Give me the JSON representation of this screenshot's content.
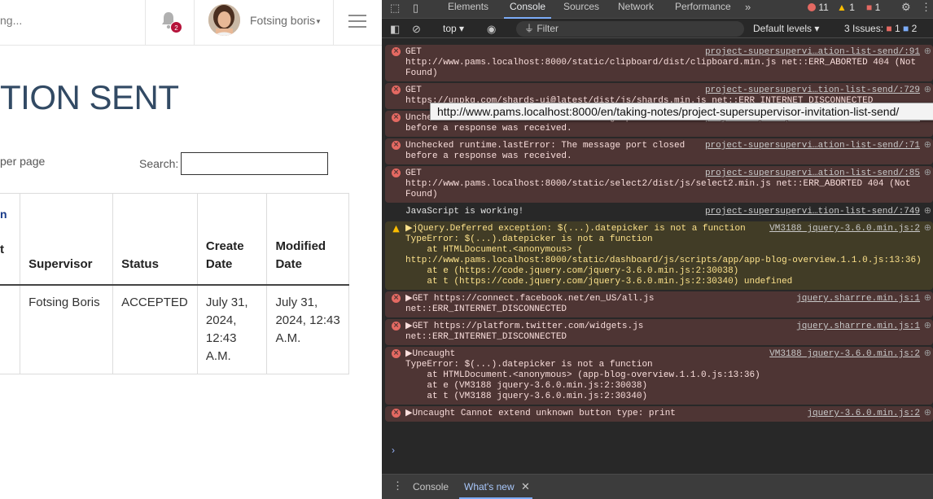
{
  "webpage": {
    "search_fragment": "ng...",
    "notifications": {
      "count": "2"
    },
    "user": {
      "name": "Fotsing boris"
    },
    "page_title": "TION SENT",
    "per_page_fragment": "per page",
    "search_label": "Search:",
    "header_fragment_top": "n",
    "header_fragment_t": "t",
    "table": {
      "headers": [
        "Supervisor",
        "Status",
        "Create Date",
        "Modified Date"
      ],
      "rows": [
        {
          "supervisor": "Fotsing Boris",
          "status": "ACCEPTED",
          "create_date": "July 31, 2024, 12:43 A.M.",
          "modified_date": "July 31, 2024, 12:43 A.M."
        }
      ]
    },
    "colors": {
      "accepted": "#2d9a2d",
      "title": "#324a64",
      "badge": "#b5123a"
    }
  },
  "devtools": {
    "tabs": [
      "Elements",
      "Console",
      "Sources",
      "Network",
      "Performance"
    ],
    "active_tab": "Console",
    "counts": {
      "errors": "11",
      "warnings": "1",
      "messages": "1"
    },
    "toolbar": {
      "context": "top",
      "filter_placeholder": "Filter",
      "levels": "Default levels",
      "issues_label": "3 Issues:",
      "issues_errors": "1",
      "issues_info": "2"
    },
    "tooltip": "http://www.pams.localhost:8000/en/taking-notes/project-supersupervisor-invitation-list-send/",
    "messages": [
      {
        "level": "error",
        "lines": [
          "GET",
          "http://www.pams.localhost:8000/static/clipboard/dist/clipboard.min.js net::ERR_ABORTED 404 (Not",
          "Found)"
        ],
        "source": "project-supersupervi…ation-list-send/:91"
      },
      {
        "level": "error",
        "lines": [
          "GET",
          "https://unpkg.com/shards-ui@latest/dist/js/shards.min.js net::ERR_INTERNET_DISCONNECTED"
        ],
        "source": "project-supersupervi…tion-list-send/:729"
      },
      {
        "level": "error",
        "lines": [
          "Unchecked runtime.lastError: The message port closed",
          "before a response was received."
        ],
        "source": "project-supersupervi…ation-list-send/:71"
      },
      {
        "level": "error",
        "lines": [
          "Unchecked runtime.lastError: The message port closed",
          "before a response was received."
        ],
        "source": "project-supersupervi…ation-list-send/:71"
      },
      {
        "level": "error",
        "lines": [
          "GET",
          "http://www.pams.localhost:8000/static/select2/dist/js/select2.min.js net::ERR_ABORTED 404 (Not",
          "Found)"
        ],
        "source": "project-supersupervi…ation-list-send/:85"
      },
      {
        "level": "info",
        "lines": [
          "JavaScript is working!"
        ],
        "source": "project-supersupervi…tion-list-send/:749"
      },
      {
        "level": "warn",
        "lines": [
          "▶jQuery.Deferred exception: $(...).datepicker is not a function",
          "TypeError: $(...).datepicker is not a function",
          "    at HTMLDocument.<anonymous> (",
          "http://www.pams.localhost:8000/static/dashboard/js/scripts/app/app-blog-overview.1.1.0.js:13:36)",
          "    at e (https://code.jquery.com/jquery-3.6.0.min.js:2:30038)",
          "    at t (https://code.jquery.com/jquery-3.6.0.min.js:2:30340) undefined"
        ],
        "source": "VM3188 jquery-3.6.0.min.js:2"
      },
      {
        "level": "error",
        "lines": [
          "▶GET https://connect.facebook.net/en_US/all.js",
          "net::ERR_INTERNET_DISCONNECTED"
        ],
        "source": "jquery.sharrre.min.js:1"
      },
      {
        "level": "error",
        "lines": [
          "▶GET https://platform.twitter.com/widgets.js",
          "net::ERR_INTERNET_DISCONNECTED"
        ],
        "source": "jquery.sharrre.min.js:1"
      },
      {
        "level": "error",
        "lines": [
          "▶Uncaught",
          "TypeError: $(...).datepicker is not a function",
          "    at HTMLDocument.<anonymous> (app-blog-overview.1.1.0.js:13:36)",
          "    at e (VM3188 jquery-3.6.0.min.js:2:30038)",
          "    at t (VM3188 jquery-3.6.0.min.js:2:30340)"
        ],
        "source": "VM3188 jquery-3.6.0.min.js:2"
      },
      {
        "level": "error",
        "lines": [
          "▶Uncaught Cannot extend unknown button type: print"
        ],
        "source": "jquery-3.6.0.min.js:2"
      }
    ],
    "drawer_tabs": [
      "Console",
      "What's new"
    ],
    "drawer_active": "What's new"
  }
}
